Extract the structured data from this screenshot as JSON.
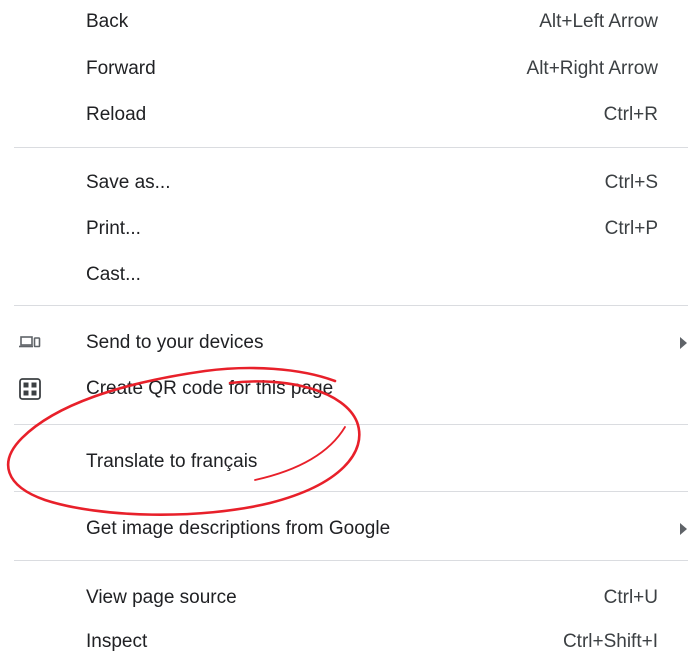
{
  "menu": {
    "items": [
      {
        "label": "Back",
        "shortcut": "Alt+Left Arrow"
      },
      {
        "label": "Forward",
        "shortcut": "Alt+Right Arrow"
      },
      {
        "label": "Reload",
        "shortcut": "Ctrl+R"
      },
      {
        "label": "Save as...",
        "shortcut": "Ctrl+S"
      },
      {
        "label": "Print...",
        "shortcut": "Ctrl+P"
      },
      {
        "label": "Cast..."
      },
      {
        "label": "Send to your devices",
        "icon": "devices-icon",
        "has_submenu": true
      },
      {
        "label": "Create QR code for this page",
        "icon": "qr-code-icon"
      },
      {
        "label": "Translate to français"
      },
      {
        "label": "Get image descriptions from Google",
        "has_submenu": true
      },
      {
        "label": "View page source",
        "shortcut": "Ctrl+U"
      },
      {
        "label": "Inspect",
        "shortcut": "Ctrl+Shift+I"
      }
    ]
  },
  "annotation": {
    "shape": "hand-drawn circle",
    "color": "#e8202a",
    "target": "Translate to français"
  }
}
